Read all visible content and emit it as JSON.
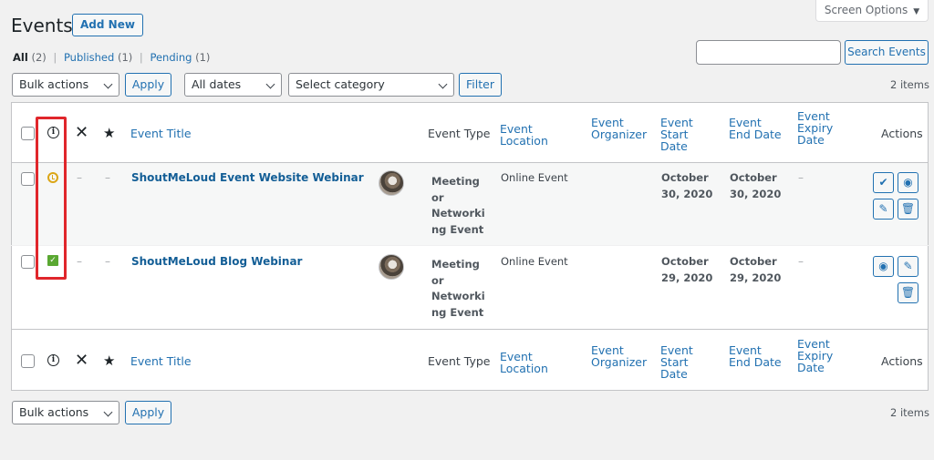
{
  "header": {
    "title": "Events",
    "add_new_label": "Add New",
    "screen_options_label": "Screen Options"
  },
  "views": [
    {
      "label": "All",
      "count": "(2)"
    },
    {
      "label": "Published",
      "count": "(1)"
    },
    {
      "label": "Pending",
      "count": "(1)"
    }
  ],
  "search": {
    "value": "",
    "button_label": "Search Events"
  },
  "top_nav": {
    "bulk_actions": "Bulk actions",
    "apply_label": "Apply",
    "dates_filter": "All dates",
    "category_filter": "Select category",
    "filter_label": "Filter",
    "items_count": "2 items"
  },
  "bottom_nav": {
    "bulk_actions": "Bulk actions",
    "apply_label": "Apply",
    "items_count": "2 items"
  },
  "columns": {
    "title": "Event Title",
    "type": "Event Type",
    "location": "Event Location",
    "organizer": "Event Organizer",
    "start": "Event Start Date",
    "end": "Event End Date",
    "expiry": "Event Expiry Date",
    "actions": "Actions"
  },
  "rows": [
    {
      "status": "pending",
      "title": "ShoutMeLoud Event Website Webinar",
      "dash": "–",
      "type_lines": [
        "Meeting",
        "or",
        "Networki",
        "ng Event"
      ],
      "location": "Online Event",
      "start_lines": [
        "October",
        "30, 2020"
      ],
      "end_lines": [
        "October",
        "30, 2020"
      ],
      "expiry": "–",
      "actions": [
        "approve-icon",
        "view-icon",
        "edit-icon",
        "delete-icon"
      ]
    },
    {
      "status": "published",
      "title": "ShoutMeLoud Blog Webinar",
      "dash": "–",
      "type_lines": [
        "Meeting",
        "or",
        "Networki",
        "ng Event"
      ],
      "location": "Online Event",
      "start_lines": [
        "October",
        "29, 2020"
      ],
      "end_lines": [
        "October",
        "29, 2020"
      ],
      "expiry": "–",
      "actions": [
        "view-icon",
        "edit-icon",
        "delete-icon"
      ]
    }
  ],
  "colors": {
    "accent": "#2271b1",
    "highlight": "#e0262b",
    "pending": "#dba617",
    "published": "#5aa832"
  }
}
